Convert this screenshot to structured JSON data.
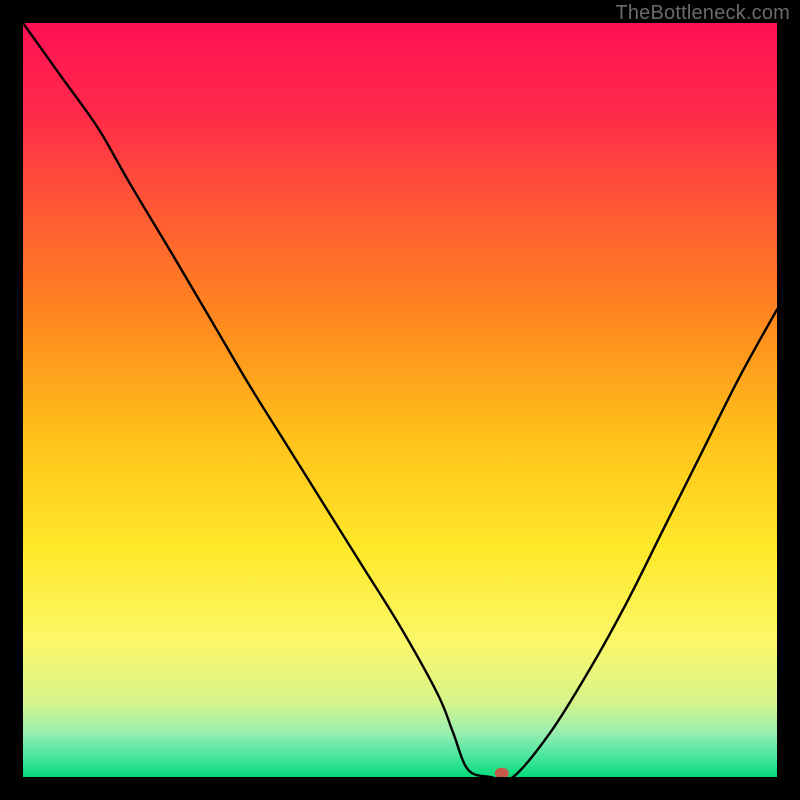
{
  "watermark": "TheBottleneck.com",
  "chart_data": {
    "type": "line",
    "title": "",
    "xlabel": "",
    "ylabel": "",
    "xlim": [
      0,
      100
    ],
    "ylim": [
      0,
      100
    ],
    "grid": false,
    "series": [
      {
        "name": "curve",
        "x": [
          0,
          5,
          10,
          14,
          20,
          25,
          30,
          35,
          40,
          45,
          50,
          55,
          57,
          59,
          62,
          65,
          70,
          75,
          80,
          85,
          90,
          95,
          100
        ],
        "y": [
          100,
          93,
          86,
          79,
          69,
          60.5,
          52,
          44,
          36,
          28,
          20,
          11,
          6,
          1,
          0,
          0,
          6,
          14,
          23,
          33,
          43,
          53,
          62
        ]
      }
    ],
    "marker": {
      "x": 63.5,
      "y": 0.5,
      "color": "#c65a4a"
    },
    "gradient_stops": [
      {
        "offset": 0.0,
        "color": "#ff1054"
      },
      {
        "offset": 0.12,
        "color": "#ff2a4a"
      },
      {
        "offset": 0.25,
        "color": "#ff5a34"
      },
      {
        "offset": 0.4,
        "color": "#ff8a1e"
      },
      {
        "offset": 0.55,
        "color": "#ffc21a"
      },
      {
        "offset": 0.7,
        "color": "#ffe92a"
      },
      {
        "offset": 0.82,
        "color": "#fcf76a"
      },
      {
        "offset": 0.9,
        "color": "#d7f48a"
      },
      {
        "offset": 0.94,
        "color": "#9aefb0"
      },
      {
        "offset": 0.97,
        "color": "#4fe6a0"
      },
      {
        "offset": 1.0,
        "color": "#06db7c"
      }
    ]
  }
}
